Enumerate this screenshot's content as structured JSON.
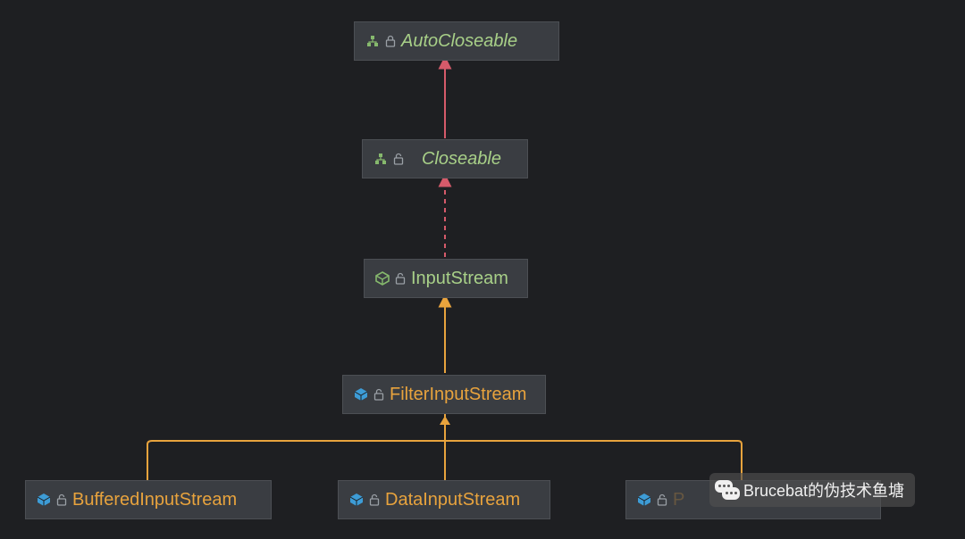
{
  "nodes": {
    "autocloseable": {
      "label": "AutoCloseable",
      "kind": "interface",
      "locked": true
    },
    "closeable": {
      "label": "Closeable",
      "kind": "interface",
      "locked": false
    },
    "inputstream": {
      "label": "InputStream",
      "kind": "abstract-class-green",
      "locked": false
    },
    "filterinputstream": {
      "label": "FilterInputStream",
      "kind": "class-orange",
      "locked": false
    },
    "bufferedinputstream": {
      "label": "BufferedInputStream",
      "kind": "class-orange",
      "locked": false
    },
    "datainputstream": {
      "label": "DataInputStream",
      "kind": "class-orange",
      "locked": false
    },
    "pushback_hidden": {
      "label": "Pushback"
    }
  },
  "edges": [
    {
      "from": "closeable",
      "to": "autocloseable",
      "style": "extends-interface"
    },
    {
      "from": "inputstream",
      "to": "closeable",
      "style": "implements"
    },
    {
      "from": "filterinputstream",
      "to": "inputstream",
      "style": "extends-class"
    },
    {
      "from": "bufferedinputstream",
      "to": "filterinputstream",
      "style": "extends-class"
    },
    {
      "from": "datainputstream",
      "to": "filterinputstream",
      "style": "extends-class"
    },
    {
      "from": "pushback_hidden",
      "to": "filterinputstream",
      "style": "extends-class"
    }
  ],
  "colors": {
    "interface_text": "#a8d088",
    "class_orange_text": "#e8a33d",
    "node_bg": "#3a3d42",
    "node_border": "#4c4f54",
    "arrow_red": "#d55a6a",
    "arrow_orange": "#e8a33d",
    "icon_blue": "#3d9cd6",
    "icon_green": "#86b96d"
  },
  "watermark": "Brucebat的伪技术鱼塘"
}
